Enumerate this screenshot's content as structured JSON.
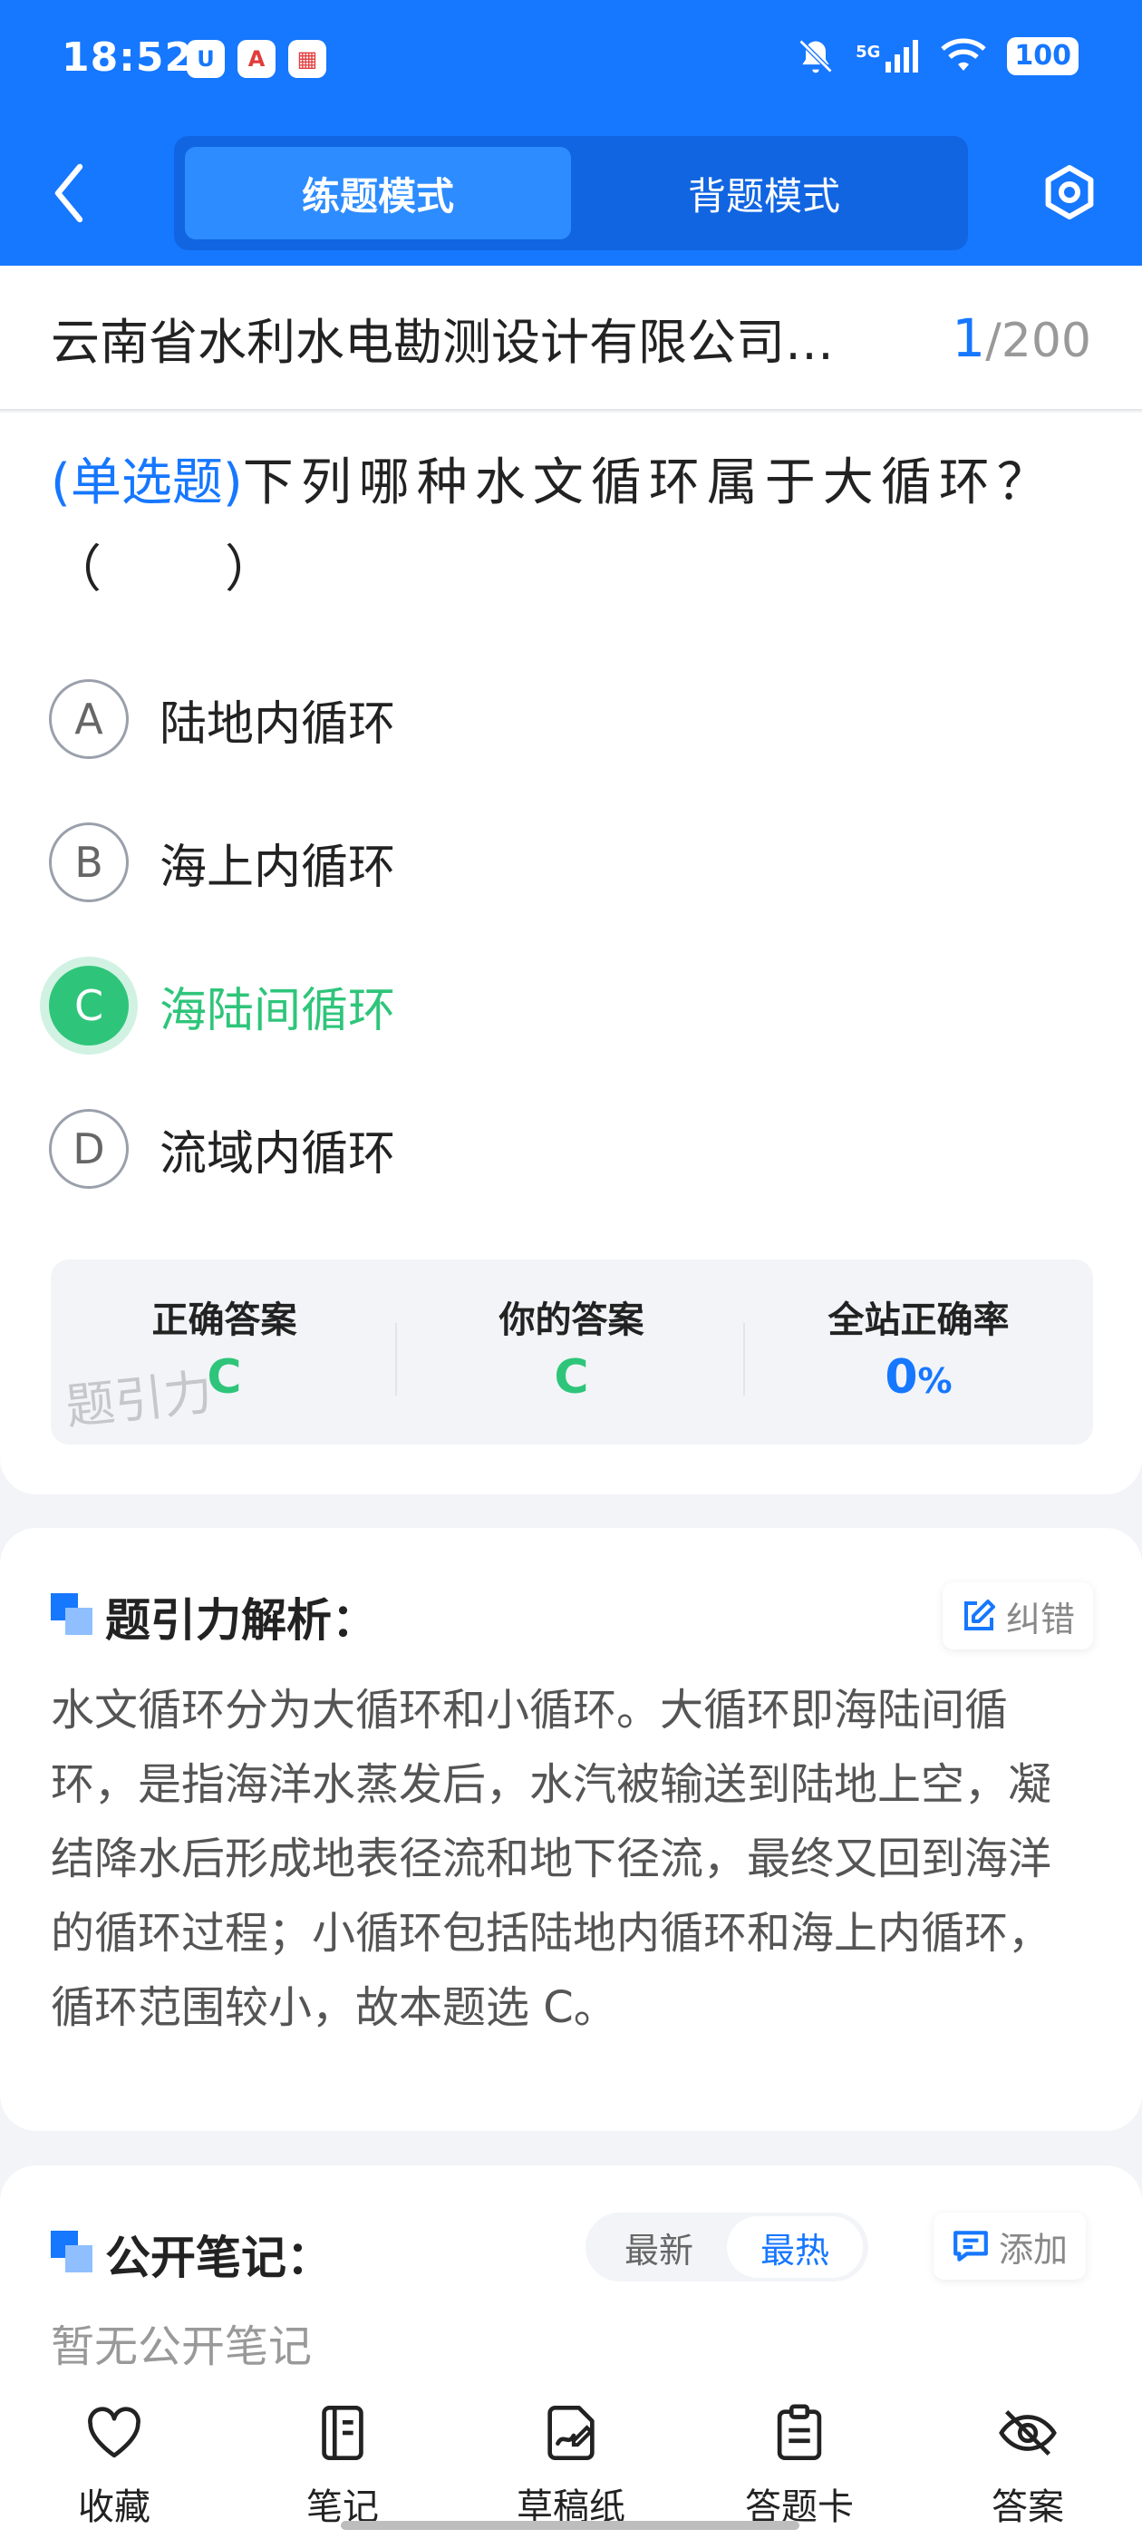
{
  "status_bar": {
    "time": "18:52",
    "network": "5G",
    "battery": "100",
    "app_icons": [
      "shield-app-icon",
      "red-app-icon",
      "qr-app-icon"
    ]
  },
  "nav": {
    "practice_mode": "练题模式",
    "memorize_mode": "背题模式"
  },
  "exam": {
    "title": "云南省水利水电勘测设计有限公司…",
    "current": "1",
    "separator": "/",
    "total": "200"
  },
  "question": {
    "type": "(单选题)",
    "text": "下列哪种水文循环属于大循环？（　　）",
    "options": [
      {
        "letter": "A",
        "text": "陆地内循环"
      },
      {
        "letter": "B",
        "text": "海上内循环"
      },
      {
        "letter": "C",
        "text": "海陆间循环"
      },
      {
        "letter": "D",
        "text": "流域内循环"
      }
    ],
    "selected": "C"
  },
  "answer_summary": {
    "correct_label": "正确答案",
    "correct_value": "C",
    "yours_label": "你的答案",
    "yours_value": "C",
    "rate_label": "全站正确率",
    "rate_value": "0",
    "rate_unit": "%",
    "watermark": "题引力"
  },
  "analysis": {
    "title": "题引力解析：",
    "report_label": "纠错",
    "text": "水文循环分为大循环和小循环。大循环即海陆间循环，是指海洋水蒸发后，水汽被输送到陆地上空，凝结降水后形成地表径流和地下径流，最终又回到海洋的循环过程；小循环包括陆地内循环和海上内循环，循环范围较小，故本题选 C。"
  },
  "notes": {
    "title": "公开笔记：",
    "sort_newest": "最新",
    "sort_hottest": "最热",
    "add_label": "添加",
    "empty_text": "暂无公开笔记"
  },
  "bottom_bar": {
    "favorite": "收藏",
    "notes": "笔记",
    "scratch": "草稿纸",
    "answer_card": "答题卡",
    "answer": "答案"
  },
  "colors": {
    "primary": "#1677ff",
    "correct": "#2ec57a",
    "background": "#f2f4f7"
  }
}
